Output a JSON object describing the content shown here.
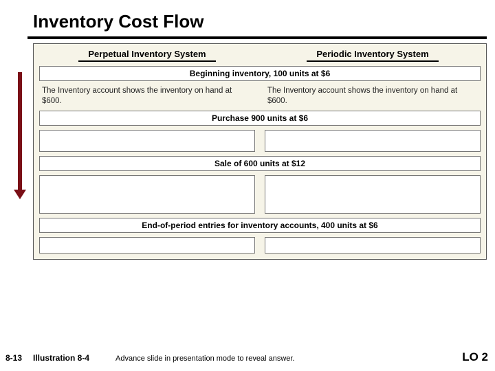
{
  "title": "Inventory Cost Flow",
  "systems": {
    "left": "Perpetual Inventory System",
    "right": "Periodic Inventory System"
  },
  "sections": {
    "beginning": "Beginning inventory, 100 units at $6",
    "purchase": "Purchase 900 units at $6",
    "sale": "Sale of 600 units at $12",
    "endperiod": "End-of-period entries for inventory accounts, 400 units at $6"
  },
  "descriptions": {
    "left": "The Inventory account shows the inventory on hand at $600.",
    "right": "The Inventory account shows the inventory on hand at $600."
  },
  "footer": {
    "page": "8-13",
    "illustration": "Illustration 8-4",
    "hint": "Advance slide in presentation mode to reveal answer.",
    "lo": "LO 2"
  }
}
